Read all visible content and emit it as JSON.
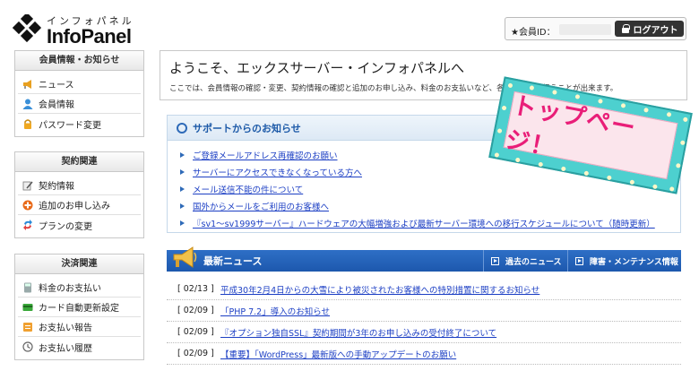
{
  "header": {
    "logo_kana": "インフォパネル",
    "logo_name": "InfoPanel",
    "member_id_label": "★会員ID：",
    "logout_label": "ログアウト"
  },
  "sidebar": [
    {
      "title": "会員情報・お知らせ",
      "items": [
        {
          "label": "ニュース",
          "icon": "megaphone-icon"
        },
        {
          "label": "会員情報",
          "icon": "person-icon"
        },
        {
          "label": "パスワード変更",
          "icon": "lock-icon"
        }
      ]
    },
    {
      "title": "契約関連",
      "items": [
        {
          "label": "契約情報",
          "icon": "contract-icon"
        },
        {
          "label": "追加のお申し込み",
          "icon": "plus-circle-icon"
        },
        {
          "label": "プランの変更",
          "icon": "change-arrows-icon"
        }
      ]
    },
    {
      "title": "決済関連",
      "items": [
        {
          "label": "料金のお支払い",
          "icon": "calculator-icon"
        },
        {
          "label": "カード自動更新設定",
          "icon": "card-icon"
        },
        {
          "label": "お支払い報告",
          "icon": "report-icon"
        },
        {
          "label": "お支払い履歴",
          "icon": "clock-icon"
        }
      ]
    }
  ],
  "welcome": {
    "title": "ようこそ、エックスサーバー・インフォパネルへ",
    "description": "ここでは、会員情報の確認・変更、契約情報の確認と追加のお申し込み、料金のお支払いなど、各種手続きを行うことが出来ます。"
  },
  "support": {
    "title": "サポートからのお知らせ",
    "links": [
      "ご登録メールアドレス再確認のお願い",
      "サーバーにアクセスできなくなっている方へ",
      "メール送信不能の件について",
      "国外からメールをご利用のお客様へ",
      "『sv1～sv1999サーバー』ハードウェアの大幅増強および最新サーバー環境への移行スケジュールについて（随時更新）"
    ]
  },
  "sticker": {
    "text": "トップページ！",
    "colors": {
      "frame": "#4dd0cf",
      "inner": "#fbe5ec",
      "text": "#e91e78"
    }
  },
  "news": {
    "title": "最新ニュース",
    "tabs": [
      "過去のニュース",
      "障害・メンテナンス情報"
    ],
    "items": [
      {
        "date": "[ 02/13 ]",
        "text": "平成30年2月4日からの大雪により被災されたお客様への特別措置に関するお知らせ"
      },
      {
        "date": "[ 02/09 ]",
        "text": "「PHP 7.2」導入のお知らせ"
      },
      {
        "date": "[ 02/09 ]",
        "text": "『オプション独自SSL』契約期間が3年のお申し込みの受付終了について"
      },
      {
        "date": "[ 02/09 ]",
        "text": "【重要】「WordPress」最新版への手動アップデートのお願い"
      }
    ]
  },
  "colors": {
    "accent_blue": "#1d58ad",
    "link": "#1c3fc4"
  }
}
